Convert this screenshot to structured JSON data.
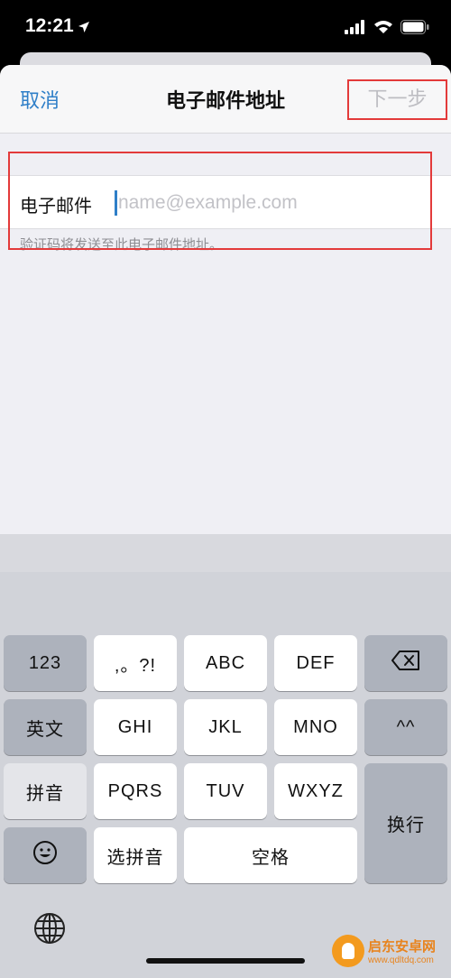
{
  "status_bar": {
    "time": "12:21",
    "icons": [
      "location-arrow-icon",
      "cellular-signal-icon",
      "wifi-icon",
      "battery-icon"
    ]
  },
  "nav": {
    "cancel_label": "取消",
    "title": "电子邮件地址",
    "next_label": "下一步"
  },
  "form": {
    "email_label": "电子邮件",
    "email_value": "",
    "email_placeholder": "name@example.com",
    "hint": "验证码将发送至此电子邮件地址。"
  },
  "keyboard": {
    "keys": {
      "numbers": "123",
      "punct": ",。?!",
      "abc": "ABC",
      "def": "DEF",
      "english": "英文",
      "ghi": "GHI",
      "jkl": "JKL",
      "mno": "MNO",
      "tone": "^^",
      "pinyin": "拼音",
      "pqrs": "PQRS",
      "tuv": "TUV",
      "wxyz": "WXYZ",
      "newline": "换行",
      "select_pinyin": "选拼音",
      "space": "空格"
    },
    "icons": [
      "backspace-icon",
      "emoji-icon",
      "globe-icon"
    ]
  },
  "watermark": {
    "name": "启东安卓网",
    "url": "www.qdltdq.com"
  },
  "colors": {
    "accent": "#2f7fc8",
    "highlight": "#e33a3a",
    "disabled_text": "#bdbdc2",
    "keyboard_bg": "#d1d3d9",
    "function_key": "#adb2bc"
  }
}
